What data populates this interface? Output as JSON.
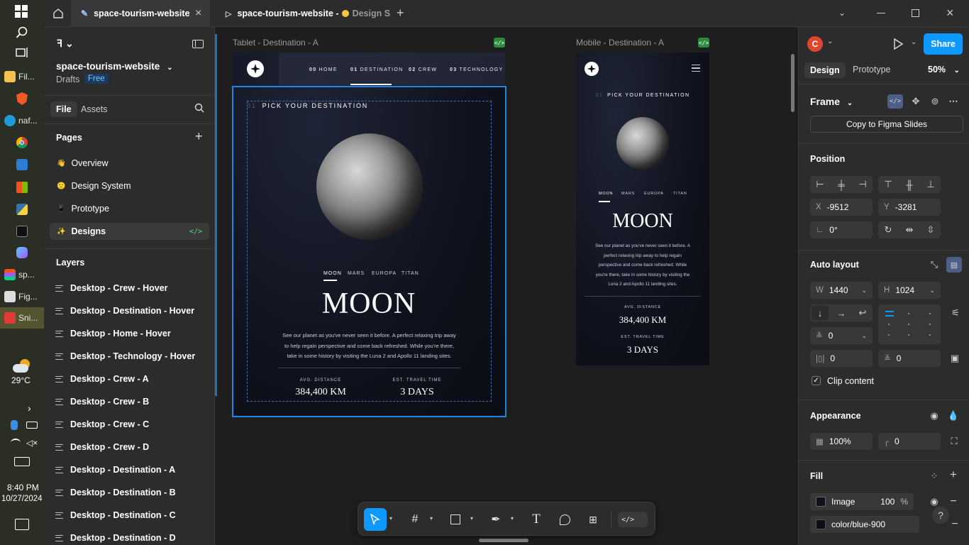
{
  "taskbar": {
    "items": [
      {
        "label": "Fil..."
      },
      {
        "label": "naf..."
      },
      {
        "label": "sp..."
      },
      {
        "label": "Fig..."
      },
      {
        "label": "Sni..."
      }
    ],
    "weather": "29°C",
    "time": "8:40 PM",
    "date": "10/27/2024"
  },
  "tabs": {
    "tab1": "space-tourism-website",
    "tab2": "space-tourism-website - ",
    "tab2_suffix": "Design S"
  },
  "file": {
    "name": "space-tourism-website",
    "location": "Drafts",
    "plan": "Free"
  },
  "leftpanel": {
    "tab_file": "File",
    "tab_assets": "Assets",
    "pages_title": "Pages",
    "pages": [
      {
        "label": "Overview",
        "emoji": "👋"
      },
      {
        "label": "Design System",
        "emoji": "🙂"
      },
      {
        "label": "Prototype",
        "emoji": "📱"
      },
      {
        "label": "Designs",
        "emoji": "✨"
      }
    ],
    "layers_title": "Layers",
    "layers": [
      "Desktop - Crew - Hover",
      "Desktop - Destination - Hover",
      "Desktop - Home - Hover",
      "Desktop - Technology - Hover",
      "Desktop - Crew - A",
      "Desktop - Crew - B",
      "Desktop - Crew - C",
      "Desktop - Crew - D",
      "Desktop - Destination - A",
      "Desktop - Destination - B",
      "Desktop - Destination - C",
      "Desktop - Destination - D"
    ]
  },
  "canvas": {
    "tablet_label": "Tablet - Destination - A",
    "mobile_label": "Mobile - Destination - A",
    "nav": [
      {
        "num": "00",
        "label": "HOME"
      },
      {
        "num": "01",
        "label": "DESTINATION"
      },
      {
        "num": "02",
        "label": "CREW"
      },
      {
        "num": "03",
        "label": "TECHNOLOGY"
      }
    ],
    "step_num": "01",
    "step_title": "PICK YOUR DESTINATION",
    "dest_tabs": [
      "MOON",
      "MARS",
      "EUROPA",
      "TITAN"
    ],
    "dest_name": "MOON",
    "description": "See our planet as you've never seen it before. A perfect relaxing trip away to help regain perspective and come back refreshed. While you're there, take in some history by visiting the Luna 2 and Apollo 11 landing sites.",
    "desc_tablet_lines": [
      "See our planet as you've never seen it before. A perfect relaxing trip away",
      "to help regain perspective and come back refreshed. While you're there,",
      "take in some history by visiting the Luna 2 and Apollo 11 landing sites."
    ],
    "desc_mobile_lines": [
      "See our planet as you've never seen it before. A",
      "perfect relaxing trip away to help regain",
      "perspective and come back refreshed. While",
      "you're there, take in some history by visiting the",
      "Luna 2 and Apollo 11 landing sites."
    ],
    "distance_label": "AVG. DISTANCE",
    "distance_value": "384,400 KM",
    "travel_label": "EST. TRAVEL TIME",
    "travel_value": "3 DAYS"
  },
  "rightpanel": {
    "avatar": "C",
    "share": "Share",
    "tab_design": "Design",
    "tab_prototype": "Prototype",
    "zoom": "50%",
    "frame_label": "Frame",
    "copy_btn": "Copy to Figma Slides",
    "position_title": "Position",
    "x_label": "X",
    "x_value": "-9512",
    "y_label": "Y",
    "y_value": "-3281",
    "rotation": "0°",
    "autolayout_title": "Auto layout",
    "w_label": "W",
    "w_value": "1440",
    "h_label": "H",
    "h_value": "1024",
    "gap_value": "0",
    "pad_h": "0",
    "pad_v": "0",
    "clip_label": "Clip content",
    "appearance_title": "Appearance",
    "opacity": "100%",
    "radius": "0",
    "fill_title": "Fill",
    "fill_type": "Image",
    "fill_opacity": "100",
    "fill_pct": "%",
    "fill_color": "color/blue-900"
  },
  "colors": {
    "accent": "#0d99ff",
    "selection": "#1e88e5",
    "bg": "#1e1e1e",
    "panel": "#2c2c2c"
  }
}
